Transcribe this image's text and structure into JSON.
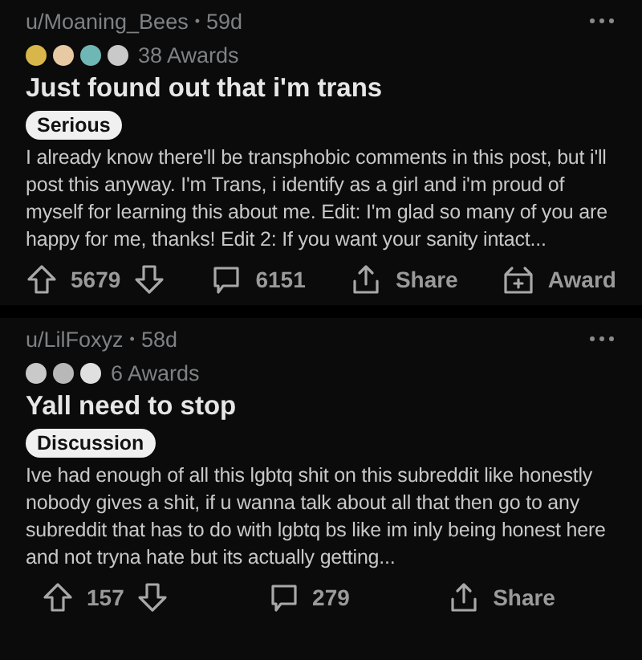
{
  "posts": [
    {
      "author": "u/Moaning_Bees",
      "separator": "•",
      "age": "59d",
      "award_icons": [
        {
          "color": "#d8b64a"
        },
        {
          "color": "#e7c9a4"
        },
        {
          "color": "#6fb7b5"
        },
        {
          "color": "#c9c9c9"
        }
      ],
      "awards": "38 Awards",
      "title": "Just found out that i'm trans",
      "flair": "Serious",
      "body": "I already know there'll be transphobic comments in this post, but i'll post this anyway. I'm Trans, i identify as a girl and i'm proud of myself for learning this about me. Edit: I'm glad so many of you are happy for me, thanks! Edit 2: If you want your sanity intact...",
      "score": "5679",
      "comments": "6151",
      "share": "Share",
      "award": "Award"
    },
    {
      "author": "u/LilFoxyz",
      "separator": "•",
      "age": "58d",
      "award_icons": [
        {
          "color": "#c9c9c9"
        },
        {
          "color": "#b8b8b8"
        },
        {
          "color": "#e0e0e0"
        }
      ],
      "awards": "6 Awards",
      "title": "Yall need to stop",
      "flair": "Discussion",
      "body": "Ive had enough of all this lgbtq shit on this subreddit like honestly nobody gives a shit, if u wanna talk about all that then go to any subreddit that has to do with lgbtq bs like im inly being honest here and not tryna hate but its actually getting...",
      "score": "157",
      "comments": "279",
      "share": "Share"
    }
  ]
}
